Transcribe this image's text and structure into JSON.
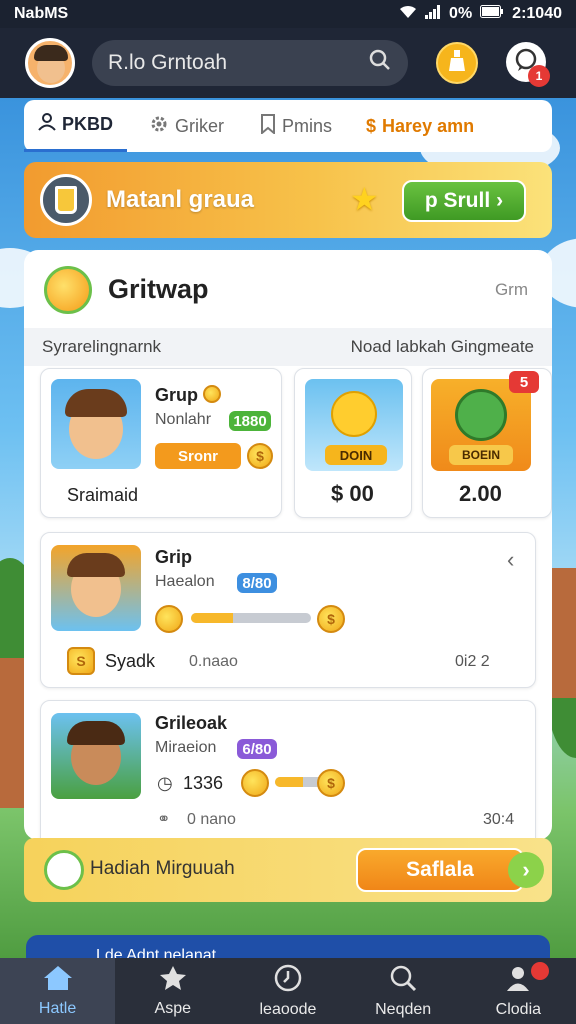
{
  "status_bar": {
    "carrier": "NabMS",
    "time": "2:1040",
    "battery": "0%"
  },
  "header": {
    "search_text": "R.lo Grntoah",
    "notification_count": "1"
  },
  "tabs": [
    {
      "label": "PKBD",
      "icon": "person-icon"
    },
    {
      "label": "Griker",
      "icon": "gear-icon"
    },
    {
      "label": "Pmins",
      "icon": "bookmark-icon"
    },
    {
      "label": "Harey amn",
      "icon": "dollar-icon"
    }
  ],
  "promo": {
    "title": "Matanl graua",
    "button": "p Srull"
  },
  "panel": {
    "title": "Gritwap",
    "right_text": "Grm",
    "sub_left": "Syrarelingnarnk",
    "sub_right": "Noad labkah Gingmeate"
  },
  "featured": {
    "name": "Grup",
    "sub": "Nonlahr",
    "badge": "1880",
    "button": "Sronr",
    "caption": "Sraimaid"
  },
  "offers": [
    {
      "label": "DOIN",
      "price": "$ 00"
    },
    {
      "label": "BOEIN",
      "price": "2.00",
      "tag": "5"
    }
  ],
  "games": [
    {
      "name": "Grip",
      "sub": "Haealon",
      "badge": "8/80",
      "footer_left": "Syadk",
      "footer_mid": "0.naao",
      "footer_right": "0i2 2"
    },
    {
      "name": "Grileoak",
      "sub": "Miraeion",
      "badge": "6/80",
      "footer_left": "1336",
      "footer_mid": "0 nano",
      "footer_right": "30:4"
    }
  ],
  "game_progress": [
    0.35,
    0.45
  ],
  "bottom_banner": {
    "text": "Hadiah Mirguuah",
    "button": "Saflala"
  },
  "peek_text": "Lde Adnt nelanat",
  "nav": [
    {
      "label": "Hatle",
      "icon": "home-icon",
      "active": true
    },
    {
      "label": "Aspe",
      "icon": "puzzle-icon",
      "active": false
    },
    {
      "label": "leaoode",
      "icon": "clock-icon",
      "active": false
    },
    {
      "label": "Neqden",
      "icon": "search-icon",
      "active": false
    },
    {
      "label": "Clodia",
      "icon": "profile-icon",
      "active": false
    }
  ],
  "colors": {
    "accent": "#f7b82a",
    "primary_dark": "#1f2636",
    "green": "#3f9a24",
    "orange": "#f08618",
    "blue": "#2a6fd0"
  }
}
